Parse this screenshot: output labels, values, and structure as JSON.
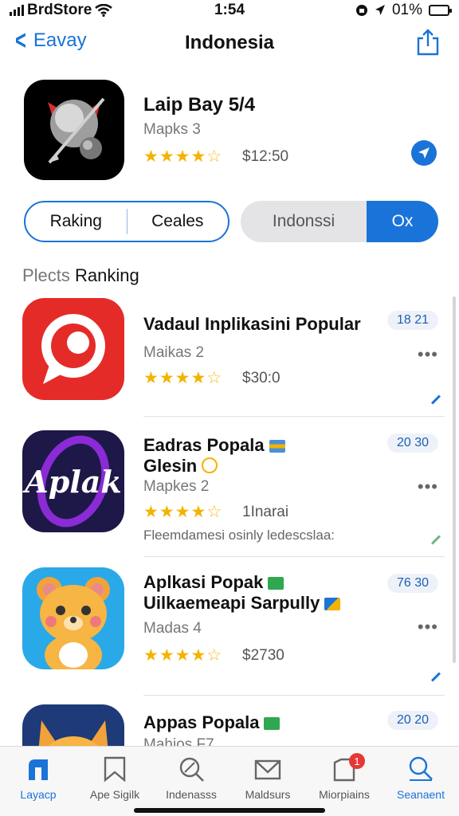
{
  "status_bar": {
    "carrier": "BrdStore",
    "time": "1:54",
    "battery": "01%"
  },
  "nav": {
    "back_label": "Eavay",
    "title": "Indonesia"
  },
  "featured": {
    "title": "Laip Bay 5/4",
    "subtitle": "Mapks 3",
    "price": "$12:50",
    "rating": 4
  },
  "segments": {
    "left": [
      "Raking",
      "Ceales"
    ],
    "right": [
      "Indonssi",
      "Ox"
    ]
  },
  "section": {
    "title_light": "Plects",
    "title_dark": "Ranking"
  },
  "apps": [
    {
      "title": "Vadaul Inplikasini Popular",
      "subtitle": "Maikas 2",
      "price": "$30:0",
      "badge": "18 21",
      "rating": 4,
      "icon_text": ""
    },
    {
      "title": "Eadras Popala",
      "title2": "Glesin",
      "subtitle": "Mapkes 2",
      "price": "1Inarai",
      "description": "Fleemdamesi osinly ledescslaa:",
      "badge": "20 30",
      "rating": 4,
      "icon_text": "Aplak"
    },
    {
      "title": "Aplkasi Popak",
      "title2": "Uilkaemeapi Sarpully",
      "subtitle": "Madas 4",
      "price": "$2730",
      "badge": "76 30",
      "rating": 4,
      "icon_text": ""
    },
    {
      "title": "Appas Popala",
      "subtitle": "Mahios F7",
      "badge": "20 20",
      "icon_text": ""
    }
  ],
  "tabs": [
    "Layacp",
    "Ape Sigilk",
    "Indenasss",
    "Maldsurs",
    "Miorpiains",
    "Seanaent"
  ],
  "tab_badge": "1",
  "colors": {
    "accent": "#1a73d8",
    "star": "#f3b300"
  }
}
